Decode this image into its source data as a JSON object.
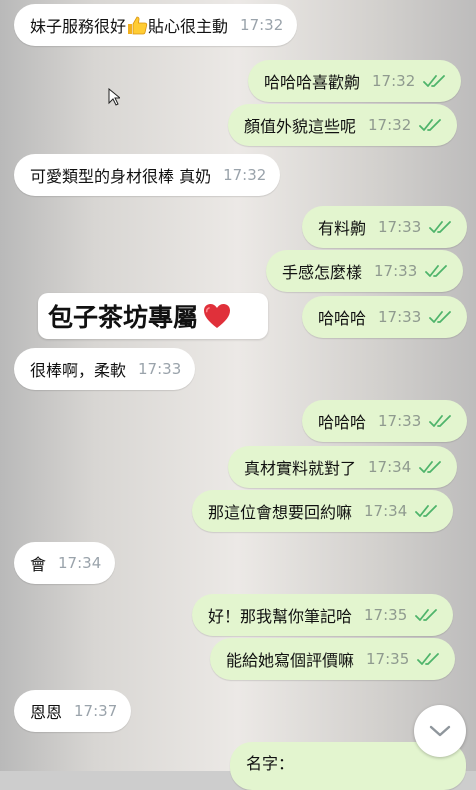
{
  "chat": {
    "messages": [
      {
        "dir": "in",
        "text": "妹子服務很好",
        "emoji": "thumbs-up",
        "text_after": "貼心很主動",
        "time": "17:32"
      },
      {
        "dir": "out",
        "text": "哈哈哈喜歡齁",
        "time": "17:32",
        "status": "read"
      },
      {
        "dir": "out",
        "text": "顏值外貌這些呢",
        "time": "17:32",
        "status": "read"
      },
      {
        "dir": "in",
        "text": "可愛類型的身材很棒 真奶",
        "time": "17:32"
      },
      {
        "dir": "out",
        "text": "有料齁",
        "time": "17:33",
        "status": "read"
      },
      {
        "dir": "out",
        "text": "手感怎麼樣",
        "time": "17:33",
        "status": "read"
      },
      {
        "dir": "out",
        "text": "哈哈哈",
        "time": "17:33",
        "status": "read"
      },
      {
        "dir": "in",
        "text": "很棒啊，柔軟",
        "time": "17:33"
      },
      {
        "dir": "out",
        "text": "哈哈哈",
        "time": "17:33",
        "status": "read"
      },
      {
        "dir": "out",
        "text": "真材實料就對了",
        "time": "17:34",
        "status": "read"
      },
      {
        "dir": "out",
        "text": "那這位會想要回約嘛",
        "time": "17:34",
        "status": "read"
      },
      {
        "dir": "in",
        "text": "會",
        "time": "17:34"
      },
      {
        "dir": "out",
        "text": "好！那我幫你筆記哈",
        "time": "17:35",
        "status": "read"
      },
      {
        "dir": "out",
        "text": "能給她寫個評價嘛",
        "time": "17:35",
        "status": "read"
      },
      {
        "dir": "in",
        "text": "恩恩",
        "time": "17:37"
      },
      {
        "dir": "out",
        "text": "名字：",
        "time": "",
        "status": ""
      }
    ]
  },
  "banner": {
    "text": "包子茶坊專屬",
    "icon": "heart-icon"
  },
  "scroll_button": {
    "icon": "chevron-down-icon"
  },
  "colors": {
    "incoming": "#ffffff",
    "outgoing": "#e3f5cf",
    "ticks": "#4fb46b",
    "heart": "#e0303a"
  }
}
